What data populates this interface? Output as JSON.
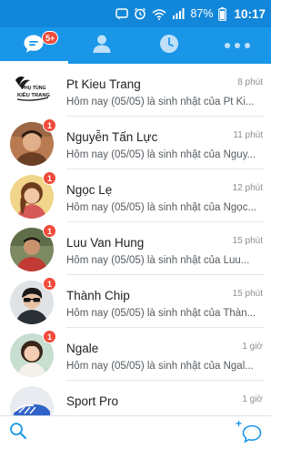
{
  "status": {
    "battery_percent": "87%",
    "time": "10:17",
    "icons": [
      "message-icon",
      "alarm-icon",
      "wifi-icon",
      "signal-icon",
      "battery-icon"
    ]
  },
  "tabs": [
    {
      "name": "messages",
      "icon": "chat-bubble-icon",
      "badge": "5+",
      "active": true
    },
    {
      "name": "contacts",
      "icon": "person-icon",
      "active": false
    },
    {
      "name": "timeline",
      "icon": "clock-icon",
      "active": false
    },
    {
      "name": "more",
      "icon": "more-dots-icon",
      "active": false
    }
  ],
  "conversations": [
    {
      "name": "Pt Kieu Trang",
      "time": "8 phút",
      "message": "Hôm nay (05/05) là sinh nhật của Pt Ki...",
      "logo_text": [
        "PHỤ TÙNG",
        "KIỀU TRANG"
      ],
      "badge": ""
    },
    {
      "name": "Nguyễn Tấn Lực",
      "time": "11 phút",
      "message": "Hôm nay (05/05) là sinh nhật của Nguy...",
      "badge": "1"
    },
    {
      "name": "Ngọc Lẹ",
      "time": "12 phút",
      "message": "Hôm nay (05/05) là sinh nhật của Ngọc...",
      "badge": "1"
    },
    {
      "name": "Luu Van Hung",
      "time": "15 phút",
      "message": "Hôm nay (05/05) là sinh nhật của Luu...",
      "badge": "1"
    },
    {
      "name": "Thành Chip",
      "time": "15 phút",
      "message": "Hôm nay (05/05) là sinh nhật của Thàn...",
      "badge": "1"
    },
    {
      "name": "Ngale",
      "time": "1 giờ",
      "message": "Hôm nay (05/05) là sinh nhật của Ngal...",
      "badge": "1"
    },
    {
      "name": "Sport Pro",
      "time": "1 giờ",
      "message": "",
      "badge": ""
    }
  ],
  "bottom": {
    "search_icon": "search-icon",
    "new_message_icon": "new-message-icon",
    "new_message_plus": "+"
  },
  "colors": {
    "status_bar": "#1287d9",
    "tab_bar": "#1996e8",
    "badge": "#f04a3a",
    "accent": "#1996e8"
  }
}
